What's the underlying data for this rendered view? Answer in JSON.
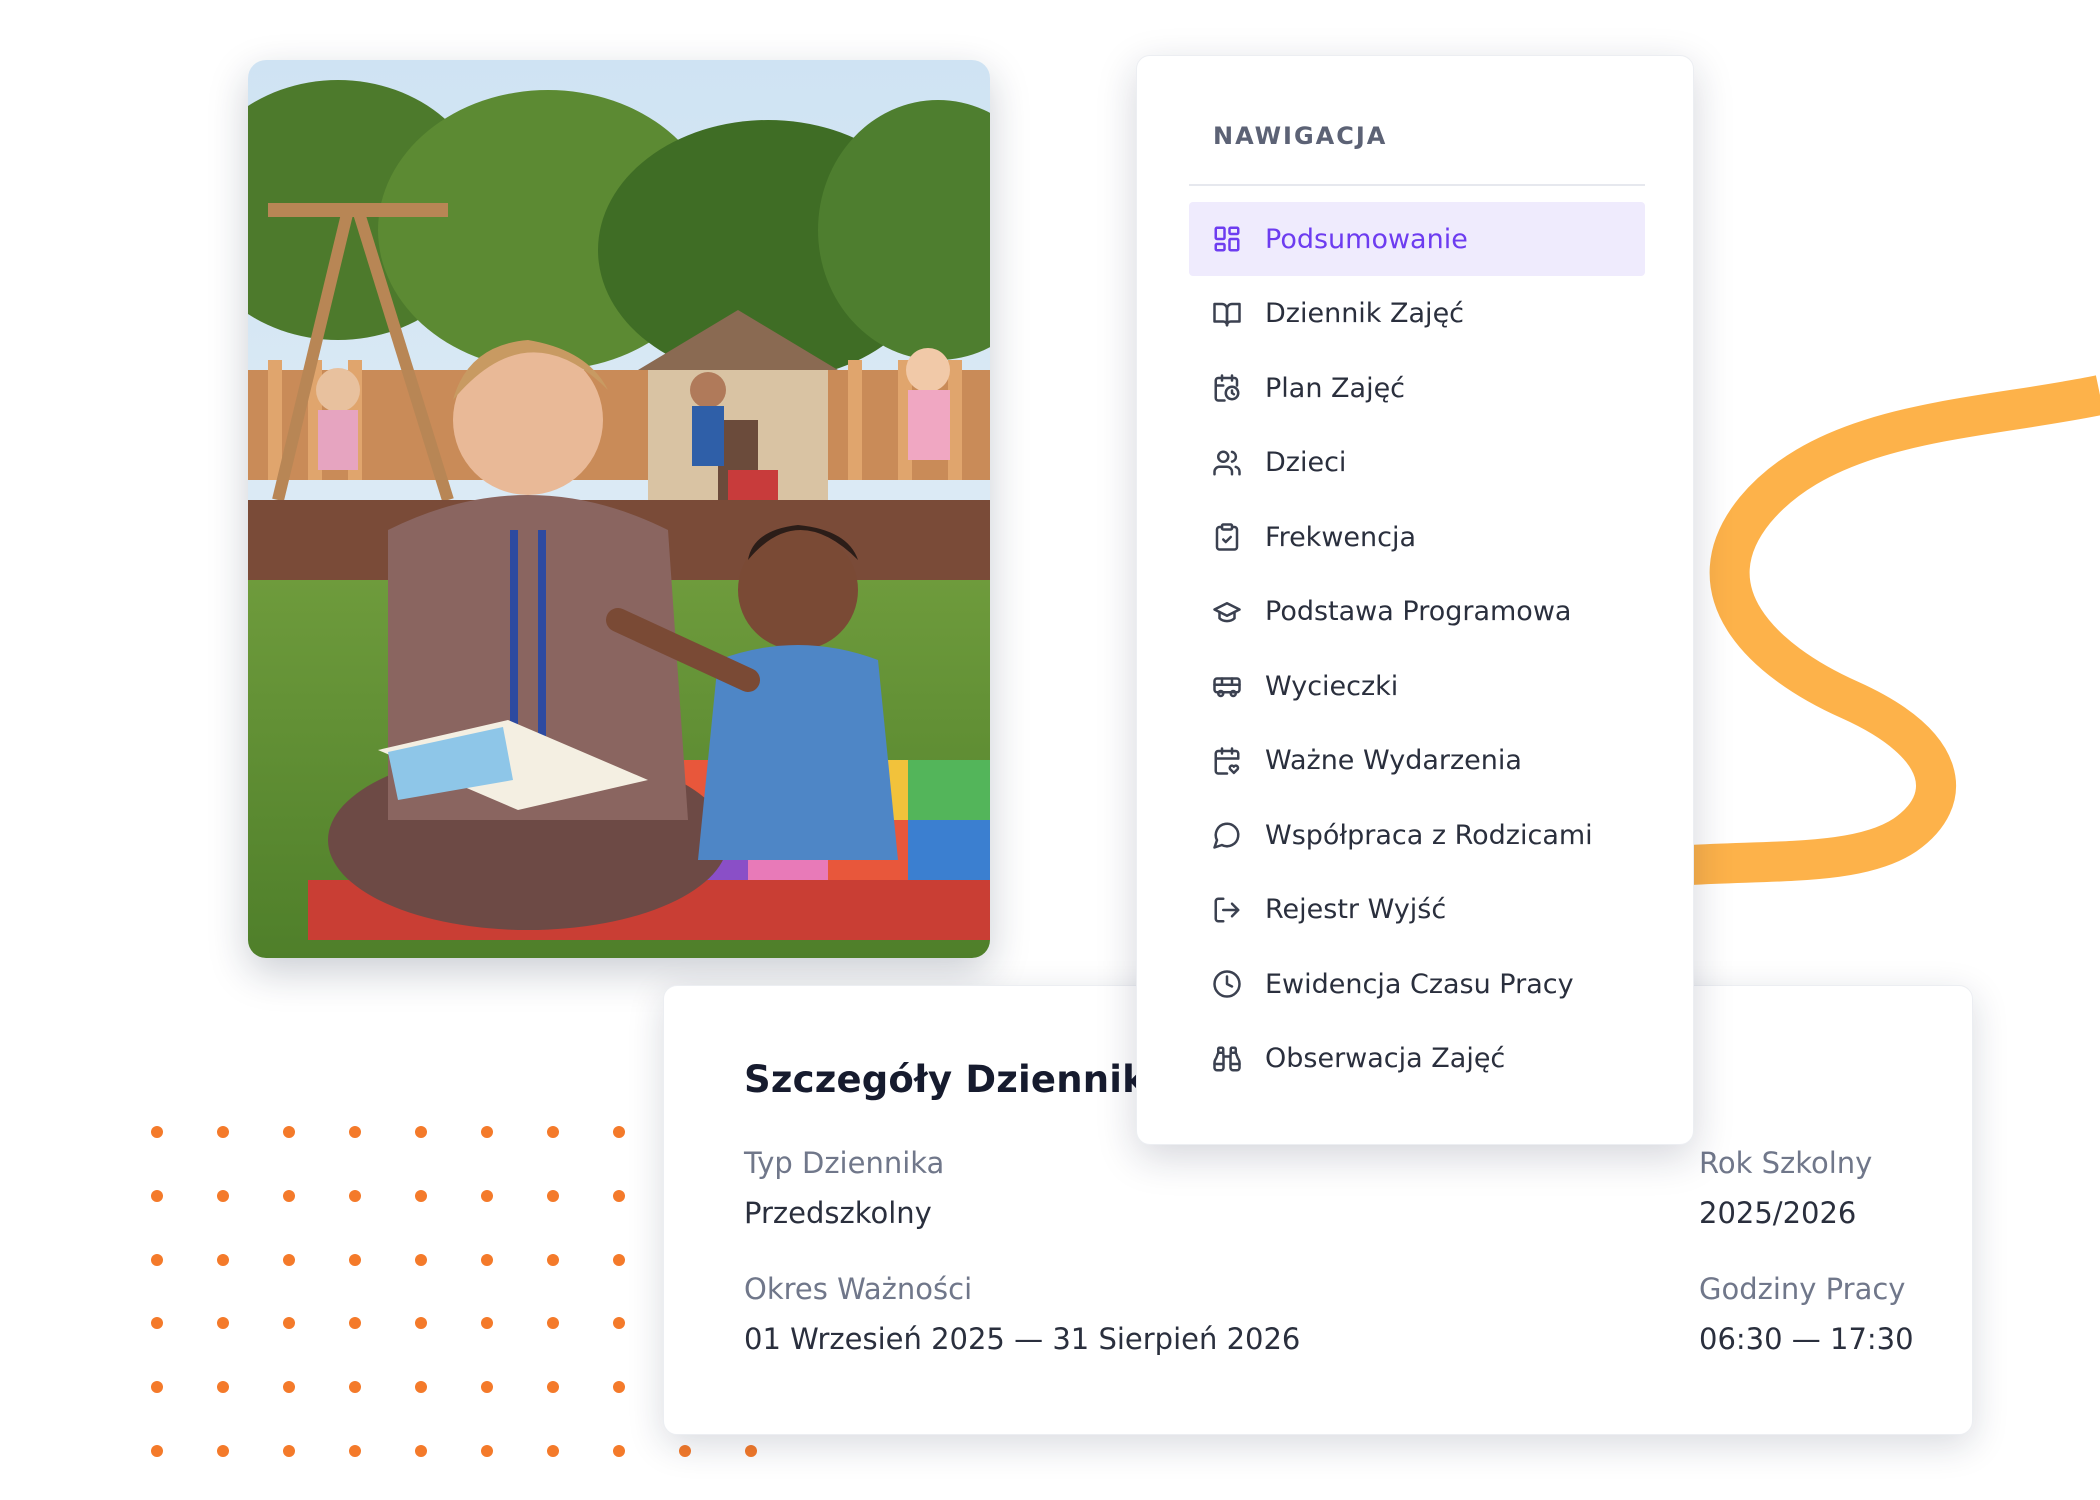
{
  "navigation": {
    "header": "NAWIGACJA",
    "items": [
      {
        "label": "Podsumowanie",
        "icon": "grid-icon",
        "active": true
      },
      {
        "label": "Dziennik Zajęć",
        "icon": "book-icon",
        "active": false
      },
      {
        "label": "Plan Zajęć",
        "icon": "calendar-clock-icon",
        "active": false
      },
      {
        "label": "Dzieci",
        "icon": "users-icon",
        "active": false
      },
      {
        "label": "Frekwencja",
        "icon": "clipboard-check-icon",
        "active": false
      },
      {
        "label": "Podstawa Programowa",
        "icon": "graduation-cap-icon",
        "active": false
      },
      {
        "label": "Wycieczki",
        "icon": "bus-icon",
        "active": false
      },
      {
        "label": "Ważne Wydarzenia",
        "icon": "calendar-heart-icon",
        "active": false
      },
      {
        "label": "Współpraca z Rodzicami",
        "icon": "chat-bubble-icon",
        "active": false
      },
      {
        "label": "Rejestr Wyjść",
        "icon": "log-out-icon",
        "active": false
      },
      {
        "label": "Ewidencja Czasu Pracy",
        "icon": "clock-icon",
        "active": false
      },
      {
        "label": "Obserwacja Zajęć",
        "icon": "binoculars-icon",
        "active": false
      }
    ]
  },
  "details": {
    "title": "Szczegóły Dziennika",
    "type_label": "Typ Dziennika",
    "type_value": "Przedszkolny",
    "year_label": "Rok Szkolny",
    "year_value": "2025/2026",
    "period_label": "Okres Ważności",
    "period_value": "01 Wrzesień 2025 — 31 Sierpień 2026",
    "hours_label": "Godziny Pracy",
    "hours_value": "06:30 — 17:30"
  },
  "colors": {
    "accent": "#6d3cf0",
    "accent_bg": "#efebfd",
    "swirl": "#fdb24a",
    "dots": "#f47a2a"
  }
}
